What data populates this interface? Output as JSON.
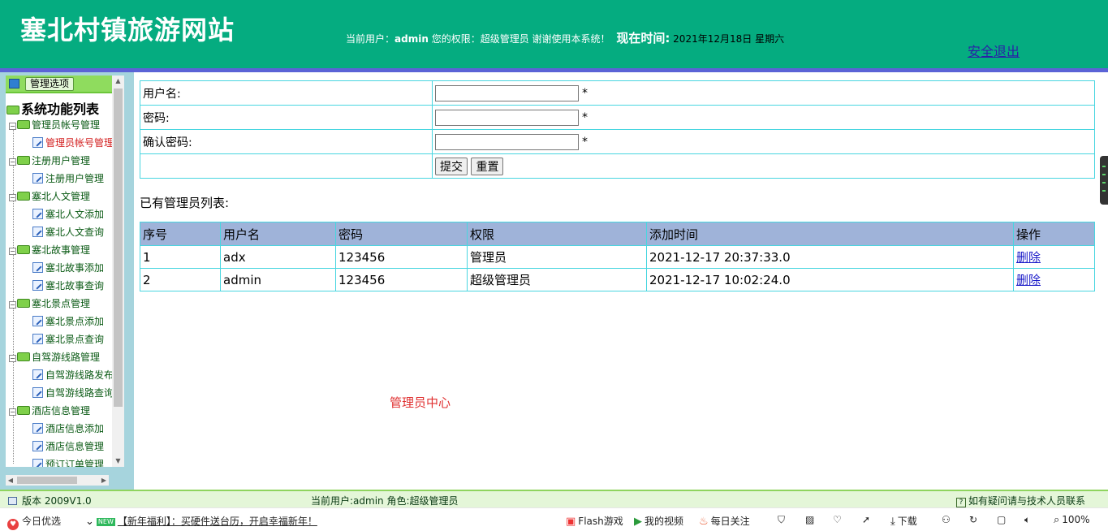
{
  "header": {
    "site_title": "塞北村镇旅游网站",
    "user_prefix": "当前用户：",
    "user_name": "admin",
    "perm_text": " 您的权限：超级管理员 谢谢使用本系统！",
    "time_label": "现在时间:",
    "time_value": "2021年12月18日 星期六",
    "logout": "安全退出"
  },
  "sidebar": {
    "options_button": "管理选项",
    "tree_title": "系统功能列表",
    "groups": [
      {
        "label": "管理员帐号管理",
        "items": [
          "管理员帐号管理"
        ]
      },
      {
        "label": "注册用户管理",
        "items": [
          "注册用户管理"
        ]
      },
      {
        "label": "塞北人文管理",
        "items": [
          "塞北人文添加",
          "塞北人文查询"
        ]
      },
      {
        "label": "塞北故事管理",
        "items": [
          "塞北故事添加",
          "塞北故事查询"
        ]
      },
      {
        "label": "塞北景点管理",
        "items": [
          "塞北景点添加",
          "塞北景点查询"
        ]
      },
      {
        "label": "自驾游线路管理",
        "items": [
          "自驾游线路发布",
          "自驾游线路查询"
        ]
      },
      {
        "label": "酒店信息管理",
        "items": [
          "酒店信息添加",
          "酒店信息管理",
          "预订订单管理"
        ]
      }
    ]
  },
  "form": {
    "username_label": "用户名:",
    "password_label": "密码:",
    "confirm_label": "确认密码:",
    "required_mark": "*",
    "submit": "提交",
    "reset": "重置"
  },
  "list": {
    "title": "已有管理员列表:",
    "columns": [
      "序号",
      "用户名",
      "密码",
      "权限",
      "添加时间",
      "操作"
    ],
    "rows": [
      [
        "1",
        "adx",
        "123456",
        "管理员",
        "2021-12-17 20:37:33.0",
        "删除"
      ],
      [
        "2",
        "admin",
        "123456",
        "超级管理员",
        "2021-12-17 10:02:24.0",
        "删除"
      ]
    ]
  },
  "center_label": "管理员中心",
  "statusbar": {
    "version": "版本 2009V1.0",
    "current": "当前用户:admin  角色:超级管理员",
    "help": "如有疑问请与技术人员联系"
  },
  "browserbar": {
    "today": "今日优选",
    "news": "【新年福利】：买硬件送台历，开启幸福新年！",
    "flash": "Flash游戏",
    "video": "我的视频",
    "follow": "每日关注",
    "download": "下载",
    "zoom": "100%"
  }
}
